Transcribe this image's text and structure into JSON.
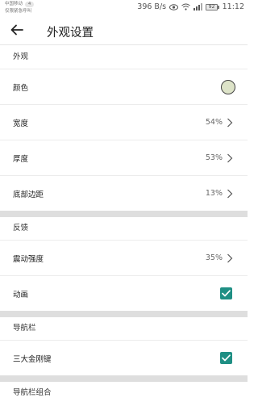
{
  "status_bar": {
    "carrier_line1": "中国移动",
    "carrier_badge": "4",
    "carrier_line2": "仅限紧急呼叫",
    "speed": "396 B/s",
    "battery": "92",
    "time": "11:12"
  },
  "app_bar": {
    "title": "外观设置"
  },
  "colors": {
    "accent": "#1f8f84",
    "swatch": "#dde3c8",
    "divider_band": "#dedede"
  },
  "sections": {
    "appearance": {
      "header": "外观",
      "color_label": "颜色",
      "width_label": "宽度",
      "width_value": "54%",
      "thickness_label": "厚度",
      "thickness_value": "53%",
      "bottom_margin_label": "底部边距",
      "bottom_margin_value": "13%"
    },
    "feedback": {
      "header": "反馈",
      "vibration_label": "震动强度",
      "vibration_value": "35%",
      "animation_label": "动画",
      "animation_checked": true
    },
    "navbar": {
      "header": "导航栏",
      "three_keys_label": "三大金刚键",
      "three_keys_checked": true
    },
    "navbar_combo": {
      "header": "导航栏组合"
    }
  }
}
